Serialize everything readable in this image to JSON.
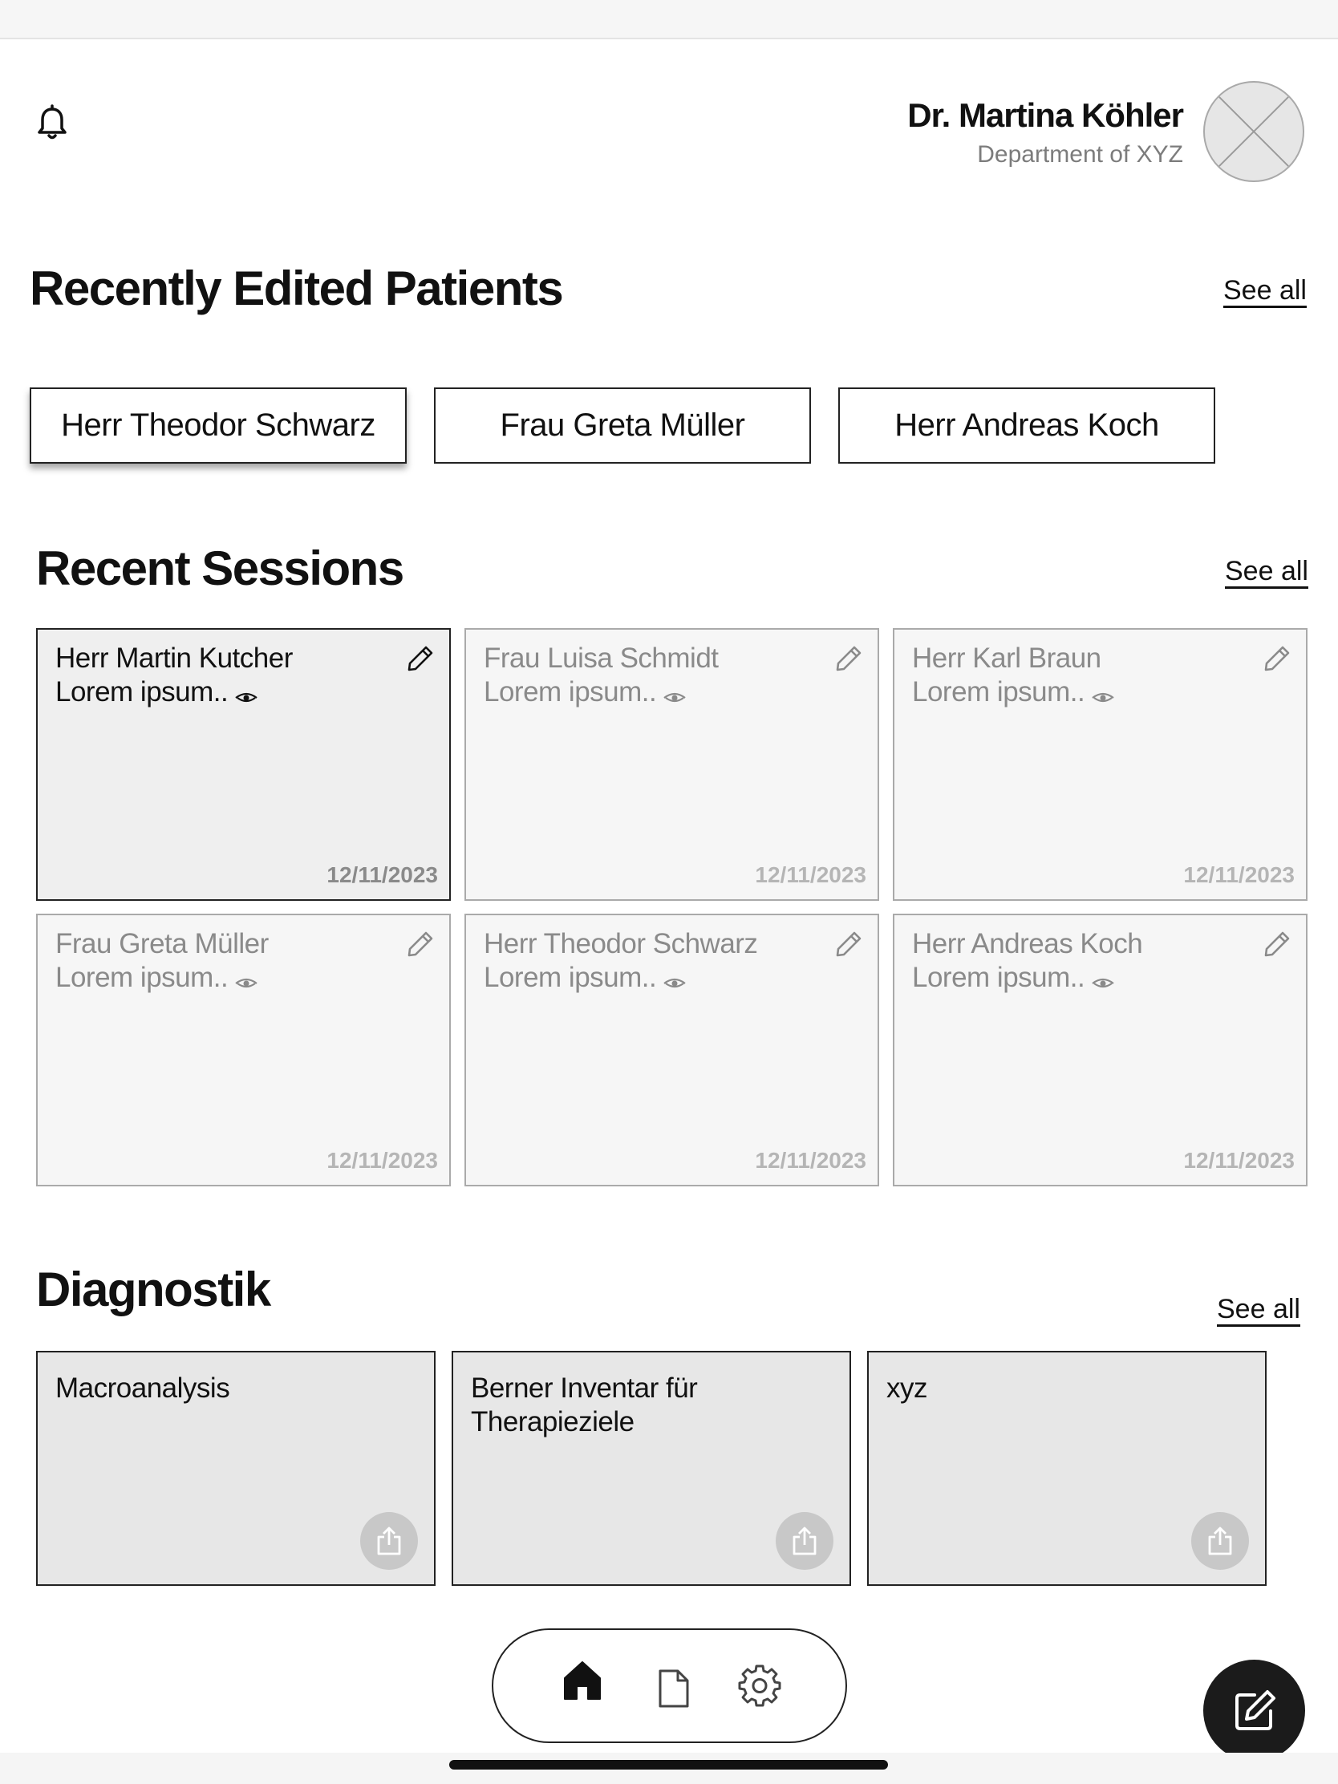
{
  "header": {
    "user_name": "Dr. Martina Köhler",
    "department": "Department of XYZ",
    "bell_icon": "bell-icon",
    "avatar_icon": "avatar-placeholder"
  },
  "recent_patients": {
    "title": "Recently Edited Patients",
    "see_all": "See all",
    "items": [
      {
        "name": "Herr Theodor Schwarz"
      },
      {
        "name": "Frau Greta Müller"
      },
      {
        "name": "Herr Andreas Koch"
      }
    ]
  },
  "recent_sessions": {
    "title": "Recent Sessions",
    "see_all": "See all",
    "items": [
      {
        "name": "Herr Martin Kutcher",
        "snippet": "Lorem ipsum..",
        "date": "12/11/2023"
      },
      {
        "name": "Frau Luisa Schmidt",
        "snippet": "Lorem ipsum..",
        "date": "12/11/2023"
      },
      {
        "name": "Herr Karl Braun",
        "snippet": "Lorem ipsum..",
        "date": "12/11/2023"
      },
      {
        "name": "Frau Greta Müller",
        "snippet": "Lorem ipsum..",
        "date": "12/11/2023"
      },
      {
        "name": "Herr Theodor Schwarz",
        "snippet": "Lorem ipsum..",
        "date": "12/11/2023"
      },
      {
        "name": "Herr Andreas Koch",
        "snippet": "Lorem ipsum..",
        "date": "12/11/2023"
      }
    ]
  },
  "diagnostik": {
    "title": "Diagnostik",
    "see_all": "See all",
    "items": [
      {
        "title": "Macroanalysis"
      },
      {
        "title": "Berner Inventar für Therapieziele"
      },
      {
        "title": "xyz"
      }
    ]
  },
  "bottom_nav": {
    "items": [
      {
        "icon": "home-icon",
        "active": true
      },
      {
        "icon": "document-icon",
        "active": false
      },
      {
        "icon": "gear-icon",
        "active": false
      }
    ]
  },
  "fab": {
    "icon": "compose-icon"
  },
  "colors": {
    "accent": "#1b1b1b",
    "active_card": "#efefef",
    "inactive_card": "#f6f6f6",
    "muted_text": "#8a8a8a",
    "diag_card": "#e7e7e7"
  }
}
